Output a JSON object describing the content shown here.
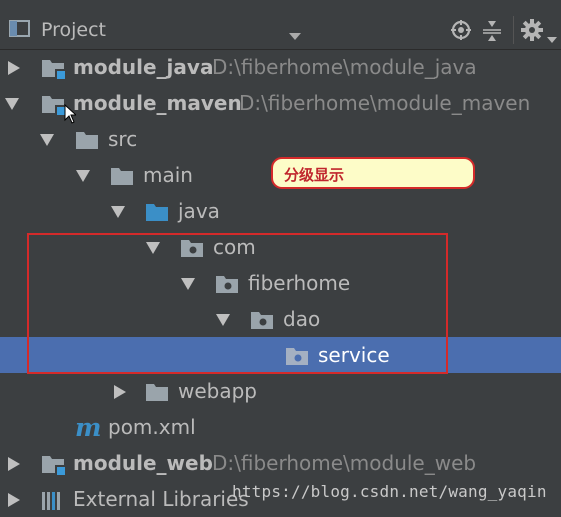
{
  "header": {
    "title": "Project"
  },
  "callout": {
    "text": "分级显示"
  },
  "tree": [
    {
      "name": "module-java",
      "label": "module_java",
      "path": "D:\\fiberhome\\module_java",
      "bold": true,
      "arrow": "right",
      "icon": "module-folder"
    },
    {
      "name": "module-maven",
      "label": "module_maven",
      "path": "D:\\fiberhome\\module_maven",
      "bold": true,
      "arrow": "down",
      "icon": "module-folder"
    },
    {
      "name": "src",
      "label": "src",
      "arrow": "down",
      "icon": "folder"
    },
    {
      "name": "main",
      "label": "main",
      "arrow": "down",
      "icon": "folder"
    },
    {
      "name": "java",
      "label": "java",
      "arrow": "down",
      "icon": "source-folder"
    },
    {
      "name": "com",
      "label": "com",
      "arrow": "down",
      "icon": "package"
    },
    {
      "name": "fiberhome",
      "label": "fiberhome",
      "arrow": "down",
      "icon": "package"
    },
    {
      "name": "dao",
      "label": "dao",
      "arrow": "down",
      "icon": "package"
    },
    {
      "name": "service",
      "label": "service",
      "icon": "package",
      "selected": true
    },
    {
      "name": "webapp",
      "label": "webapp",
      "arrow": "right",
      "icon": "folder"
    },
    {
      "name": "pom-xml",
      "label": "pom.xml",
      "icon": "maven-file"
    },
    {
      "name": "module-web",
      "label": "module_web",
      "path": "D:\\fiberhome\\module_web",
      "bold": true,
      "arrow": "right",
      "icon": "module-folder"
    },
    {
      "name": "external-libraries",
      "label": "External Libraries",
      "arrow": "right",
      "icon": "libraries"
    }
  ],
  "watermark": "https://blog.csdn.net/wang_yaqin",
  "colors": {
    "background": "#3c3f41",
    "selection": "#4b6eaf",
    "annotation": "#d42a2a",
    "callout_bg": "#fdfcc8"
  }
}
